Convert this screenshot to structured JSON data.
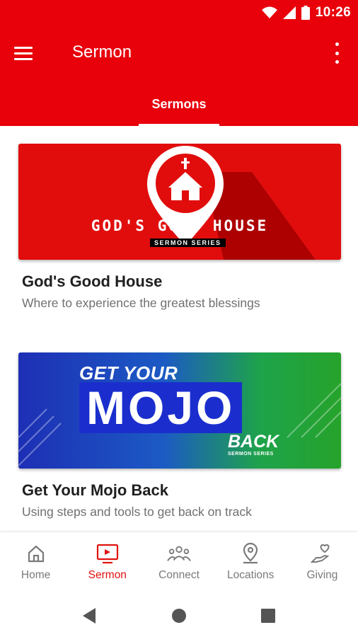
{
  "status_bar": {
    "time": "10:26"
  },
  "app_bar": {
    "title": "Sermon",
    "tab_label": "Sermons"
  },
  "colors": {
    "brand_red": "#e8000b",
    "active_nav": "#e0120e",
    "inactive_nav": "#7a7a7a"
  },
  "cards": [
    {
      "title": "God's Good House",
      "subtitle": "Where to experience the greatest blessings",
      "banner_title": "GOD'S GOOD HOUSE",
      "banner_subtitle": "SERMON SERIES"
    },
    {
      "title": "Get Your Mojo Back",
      "subtitle": "Using steps and tools to get back on track",
      "banner_line1": "GET YOUR",
      "banner_line2": "MOJO",
      "banner_line3": "BACK",
      "banner_subtitle": "SERMON SERIES"
    }
  ],
  "bottom_nav": [
    {
      "label": "Home",
      "icon": "home-icon",
      "active": false
    },
    {
      "label": "Sermon",
      "icon": "tv-icon",
      "active": true
    },
    {
      "label": "Connect",
      "icon": "people-icon",
      "active": false
    },
    {
      "label": "Locations",
      "icon": "location-pin-icon",
      "active": false
    },
    {
      "label": "Giving",
      "icon": "heart-hand-icon",
      "active": false
    }
  ],
  "system_nav": [
    "back-icon",
    "home-circle-icon",
    "recents-icon"
  ]
}
